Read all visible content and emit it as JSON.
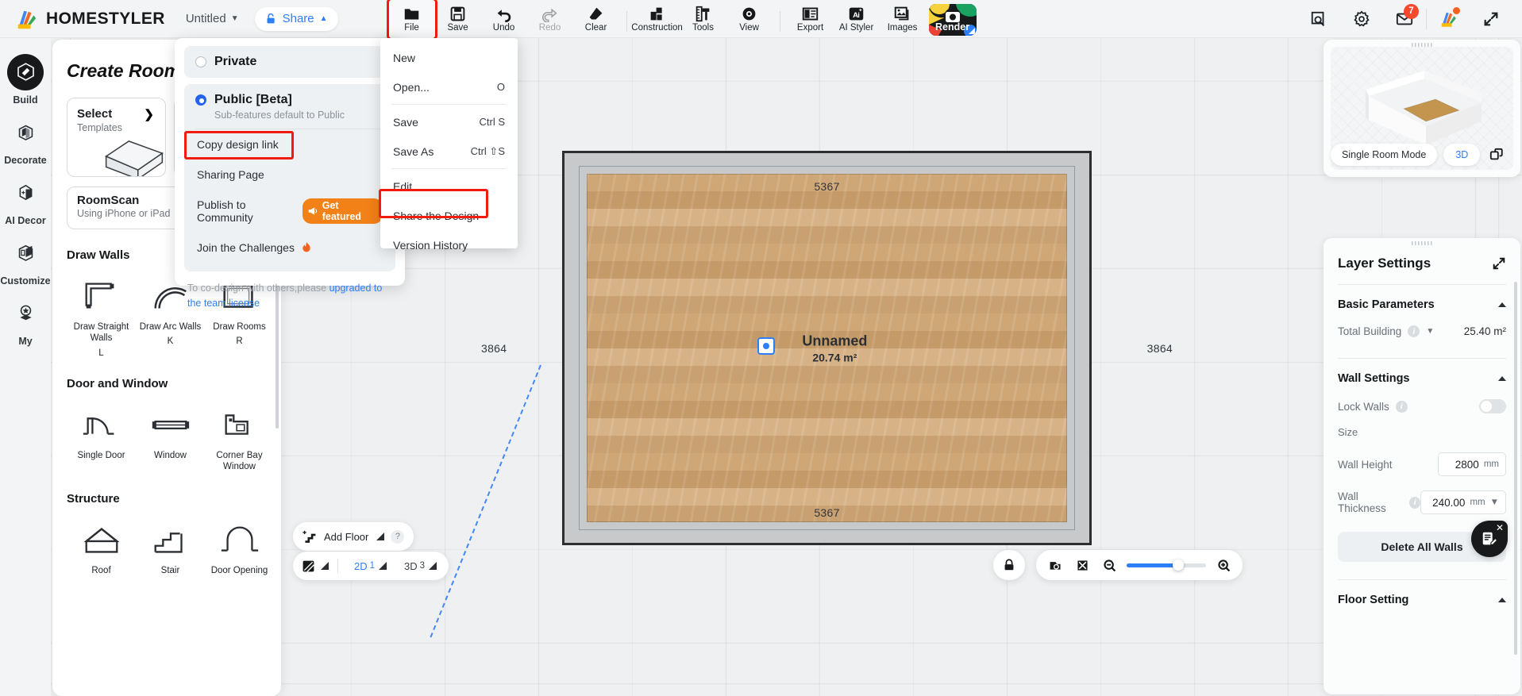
{
  "app": {
    "brand": "HOMESTYLER",
    "doc_title": "Untitled",
    "share_label": "Share"
  },
  "toolbar": {
    "items": [
      {
        "label": "File",
        "icon": "folder-icon",
        "disabled": false,
        "highlighted": true
      },
      {
        "label": "Save",
        "icon": "floppy-disk-icon",
        "disabled": false,
        "highlighted": false
      },
      {
        "label": "Undo",
        "icon": "undo-arrow-icon",
        "disabled": false,
        "highlighted": false
      },
      {
        "label": "Redo",
        "icon": "redo-arrow-icon",
        "disabled": true,
        "highlighted": false
      },
      {
        "label": "Clear",
        "icon": "eraser-icon",
        "disabled": false,
        "highlighted": false
      },
      {
        "label": "Construction",
        "icon": "construction-icon",
        "disabled": false,
        "highlighted": false
      },
      {
        "label": "Tools",
        "icon": "ruler-brush-icon",
        "disabled": false,
        "highlighted": false
      },
      {
        "label": "View",
        "icon": "eye-icon",
        "disabled": false,
        "highlighted": false
      },
      {
        "label": "Export",
        "icon": "export-layout-icon",
        "disabled": false,
        "highlighted": false
      },
      {
        "label": "AI Styler",
        "icon": "ai-styler-icon",
        "disabled": false,
        "highlighted": false
      },
      {
        "label": "Images",
        "icon": "images-icon",
        "disabled": false,
        "highlighted": false
      }
    ],
    "render_label": "Render"
  },
  "header_icons": [
    {
      "name": "search-design-icon",
      "badge": null
    },
    {
      "name": "gear-icon",
      "badge": null
    },
    {
      "name": "mail-icon",
      "badge": "7"
    },
    {
      "name": "homestyler-logo-icon",
      "badge": null
    },
    {
      "name": "fullscreen-icon",
      "badge": null
    }
  ],
  "rail": {
    "items": [
      {
        "label": "Build",
        "icon": "cube-build-icon",
        "active": true
      },
      {
        "label": "Decorate",
        "icon": "armchair-icon",
        "active": false
      },
      {
        "label": "AI Decor",
        "icon": "ai-magic-icon",
        "active": false
      },
      {
        "label": "Customize",
        "icon": "cabinet-icon",
        "active": false
      },
      {
        "label": "My",
        "icon": "star-badge-icon",
        "active": false
      }
    ]
  },
  "create_room": {
    "title": "Create Room",
    "cards": [
      {
        "title": "Select",
        "subtitle": "Templates",
        "icon": "room-corner-icon"
      },
      {
        "title": "",
        "subtitle": "",
        "icon": "blank-card-icon"
      }
    ],
    "roomscan": {
      "title": "RoomScan",
      "subtitle": "Using iPhone or iPad"
    },
    "sections": [
      {
        "heading": "Draw Walls",
        "items": [
          {
            "label": "Draw Straight Walls",
            "key": "L",
            "icon": "straight-wall-icon"
          },
          {
            "label": "Draw Arc Walls",
            "key": "K",
            "icon": "arc-wall-icon"
          },
          {
            "label": "Draw Rooms",
            "key": "R",
            "icon": "draw-room-icon"
          }
        ]
      },
      {
        "heading": "Door and Window",
        "items": [
          {
            "label": "Single Door",
            "key": "",
            "icon": "single-door-icon"
          },
          {
            "label": "Window",
            "key": "",
            "icon": "window-icon"
          },
          {
            "label": "Corner Bay Window",
            "key": "",
            "icon": "corner-bay-window-icon"
          }
        ]
      },
      {
        "heading": "Structure",
        "items": [
          {
            "label": "Roof",
            "key": "",
            "icon": "roof-icon"
          },
          {
            "label": "Stair",
            "key": "",
            "icon": "stair-icon"
          },
          {
            "label": "Door Opening",
            "key": "",
            "icon": "door-opening-icon"
          }
        ]
      }
    ]
  },
  "share_panel": {
    "private": {
      "label": "Private",
      "selected": false
    },
    "public": {
      "label": "Public [Beta]",
      "selected": true,
      "subtitle": "Sub-features default to Public"
    },
    "items": [
      {
        "label": "Copy design link",
        "badge": null,
        "highlighted": true
      },
      {
        "label": "Sharing Page",
        "badge": null,
        "highlighted": false
      },
      {
        "label": "Publish to Community",
        "badge": "Get featured",
        "highlighted": false
      },
      {
        "label": "Join the Challenges",
        "badge": null,
        "highlighted": false
      }
    ],
    "footer_text": "To co-design with others,please ",
    "footer_link": "upgraded to the team license"
  },
  "file_menu": {
    "items": [
      {
        "label": "New",
        "shortcut": "",
        "separator_after": false,
        "highlighted": false
      },
      {
        "label": "Open...",
        "shortcut": "O",
        "separator_after": true,
        "highlighted": false
      },
      {
        "label": "Save",
        "shortcut": "Ctrl S",
        "separator_after": false,
        "highlighted": false
      },
      {
        "label": "Save As",
        "shortcut": "Ctrl ⇧S",
        "separator_after": true,
        "highlighted": false
      },
      {
        "label": "Edit",
        "shortcut": "",
        "separator_after": false,
        "highlighted": false
      },
      {
        "label": "Share the Design",
        "shortcut": "",
        "separator_after": false,
        "highlighted": true
      },
      {
        "label": "Version History",
        "shortcut": "",
        "separator_after": false,
        "highlighted": false
      }
    ]
  },
  "canvas": {
    "room_name": "Unnamed",
    "room_area": "20.74 m²",
    "dim_top": "5367",
    "dim_bottom": "5367",
    "dim_left": "3864",
    "dim_right": "3864"
  },
  "preview": {
    "mode_label": "Single Room Mode",
    "view_label": "3D",
    "popout_icon": "popout-window-icon"
  },
  "layer_settings": {
    "title": "Layer Settings",
    "expand_icon": "expand-diagonal-icon",
    "basic": {
      "heading": "Basic Parameters",
      "total_building_label": "Total Building",
      "total_building_value": "25.40 m²"
    },
    "wall": {
      "heading": "Wall Settings",
      "lock_walls_label": "Lock Walls",
      "lock_walls_on": false,
      "size_label": "Size",
      "wall_height_label": "Wall Height",
      "wall_height_value": "2800",
      "wall_height_unit": "mm",
      "wall_thickness_label": "Wall Thickness",
      "wall_thickness_value": "240.00",
      "wall_thickness_unit": "mm",
      "delete_all_walls": "Delete All Walls"
    },
    "floor": {
      "heading": "Floor Setting"
    }
  },
  "bottom": {
    "add_floor_label": "Add Floor",
    "help_label": "?",
    "view_2d_label": "2D",
    "view_2d_count": "1",
    "view_3d_label": "3D",
    "view_3d_count": "3",
    "lock_icon": "lock-icon",
    "camera_icon": "camera-view-icon",
    "fit_icon": "fit-screen-icon",
    "zoom_out_icon": "zoom-out-icon",
    "zoom_in_icon": "zoom-in-icon"
  },
  "colors": {
    "accent": "#2d7ff9",
    "highlight": "#ef1c0f",
    "orange": "#f28117",
    "dark": "#17191b"
  }
}
